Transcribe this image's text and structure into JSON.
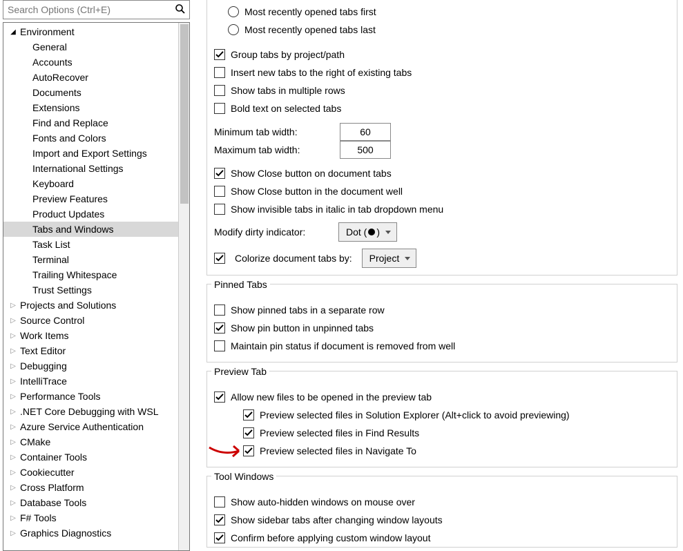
{
  "search": {
    "placeholder": "Search Options (Ctrl+E)"
  },
  "tree": {
    "env": "Environment",
    "env_children": [
      "General",
      "Accounts",
      "AutoRecover",
      "Documents",
      "Extensions",
      "Find and Replace",
      "Fonts and Colors",
      "Import and Export Settings",
      "International Settings",
      "Keyboard",
      "Preview Features",
      "Product Updates",
      "Tabs and Windows",
      "Task List",
      "Terminal",
      "Trailing Whitespace",
      "Trust Settings"
    ],
    "collapsed": [
      "Projects and Solutions",
      "Source Control",
      "Work Items",
      "Text Editor",
      "Debugging",
      "IntelliTrace",
      "Performance Tools",
      ".NET Core Debugging with WSL",
      "Azure Service Authentication",
      "CMake",
      "Container Tools",
      "Cookiecutter",
      "Cross Platform",
      "Database Tools",
      "F# Tools",
      "Graphics Diagnostics"
    ]
  },
  "tabs_group": {
    "radio_first": "Most recently opened tabs first",
    "radio_last": "Most recently opened tabs last",
    "chk_group": "Group tabs by project/path",
    "chk_insert_right": "Insert new tabs to the right of existing tabs",
    "chk_multi_rows": "Show tabs in multiple rows",
    "chk_bold_sel": "Bold text on selected tabs",
    "min_label": "Minimum tab width:",
    "min_value": "60",
    "max_label": "Maximum tab width:",
    "max_value": "500",
    "chk_close_doc": "Show Close button on document tabs",
    "chk_close_well": "Show Close button in the document well",
    "chk_invisible_italic": "Show invisible tabs in italic in tab dropdown menu",
    "dirty_label": "Modify dirty indicator:",
    "dirty_value_prefix": "Dot (",
    "dirty_value_suffix": ")",
    "chk_colorize": "Colorize document tabs by:",
    "colorize_value": "Project"
  },
  "pinned": {
    "title": "Pinned Tabs",
    "chk_separate": "Show pinned tabs in a separate row",
    "chk_pin_unpinned": "Show pin button in unpinned tabs",
    "chk_maintain": "Maintain pin status if document is removed from well"
  },
  "preview": {
    "title": "Preview Tab",
    "chk_allow": "Allow new files to be opened in the preview tab",
    "chk_sol": "Preview selected files in Solution Explorer (Alt+click to avoid previewing)",
    "chk_find": "Preview selected files in Find Results",
    "chk_nav": "Preview selected files in Navigate To"
  },
  "toolwin": {
    "title": "Tool Windows",
    "chk_auto": "Show auto-hidden windows on mouse over",
    "chk_sidebar": "Show sidebar tabs after changing window layouts",
    "chk_confirm": "Confirm before applying custom window layout"
  }
}
